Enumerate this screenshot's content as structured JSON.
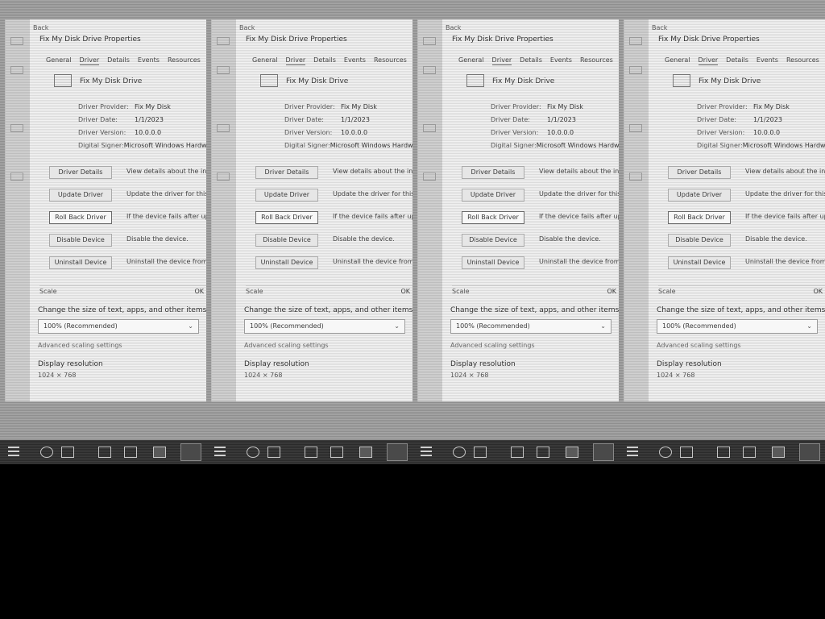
{
  "window": {
    "back_label": "Back",
    "dialog_title": "Fix My Disk Drive Properties",
    "tabs": [
      "General",
      "Driver",
      "Details",
      "Events",
      "Resources"
    ],
    "active_tab": "Driver",
    "device_name": "Fix My Disk Drive"
  },
  "driver_info": [
    {
      "key": "Driver Provider:",
      "value": "Fix My Disk"
    },
    {
      "key": "Driver Date:",
      "value": "1/1/2023"
    },
    {
      "key": "Driver Version:",
      "value": "10.0.0.0"
    },
    {
      "key": "Digital Signer:",
      "value": "Microsoft Windows Hardware Compatibility Publisher"
    }
  ],
  "driver_buttons": [
    {
      "label": "Driver Details",
      "desc": "View details about the installed driver files."
    },
    {
      "label": "Update Driver",
      "desc": "Update the driver for this device."
    },
    {
      "label": "Roll Back Driver",
      "desc": "If the device fails after updating the driver, roll back to the previously installed driver."
    },
    {
      "label": "Disable Device",
      "desc": "Disable the device."
    },
    {
      "label": "Uninstall Device",
      "desc": "Uninstall the device from the system (Advanced)."
    }
  ],
  "dialog_footer": {
    "label": "Scale",
    "close_label": "OK"
  },
  "settings": {
    "scale_title": "Change the size of text, apps, and other items",
    "scale_value": "100% (Recommended)",
    "advanced_link": "Advanced scaling settings",
    "resolution_title": "Display resolution",
    "resolution_value": "1024 × 768"
  },
  "colors": {
    "desktop_bg": "#9a9a9a",
    "window_bg": "#eeeeee",
    "taskbar_bg": "#333333"
  },
  "taskbar": {
    "icons": [
      "start-icon",
      "search-icon",
      "task-view-icon",
      "edge-icon",
      "file-explorer-icon",
      "store-icon",
      "mail-icon",
      "settings-icon"
    ]
  }
}
